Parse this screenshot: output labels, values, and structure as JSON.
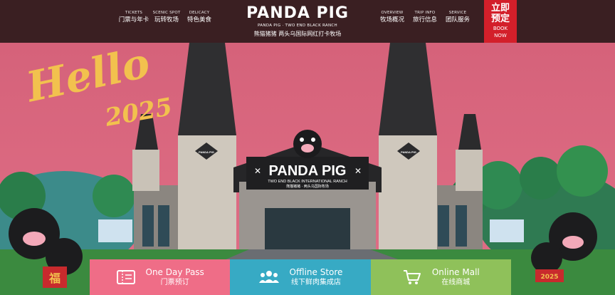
{
  "header": {
    "nav_left": [
      {
        "en": "TICKETS",
        "zh": "门票与年卡"
      },
      {
        "en": "SCENIC SPOT",
        "zh": "玩转牧场"
      },
      {
        "en": "DELICACY",
        "zh": "特色美食"
      }
    ],
    "logo": {
      "title": "PANDA PIG",
      "sub_en": "PANDA PIG · TWO END BLACK RANCH",
      "sub_zh": "熊猫猪猪 两头乌国际网红打卡牧场"
    },
    "nav_right": [
      {
        "en": "OVERVIEW",
        "zh": "牧场概况"
      },
      {
        "en": "TRIP INFO",
        "zh": "旅行信息"
      },
      {
        "en": "SERVICE",
        "zh": "团队服务"
      }
    ],
    "book": {
      "zh1": "立即",
      "zh2": "预定",
      "en1": "BOOK",
      "en2": "NOW"
    }
  },
  "hero": {
    "script_text": "Hello",
    "year_text": "2025",
    "sign_title": "PANDA PIG",
    "sign_sub": "TWO END BLACK INTERNATIONAL RANCH",
    "sign_zh": "熊猫猪猪 · 两头乌国际牧场",
    "tower_badge": "PANDA PIG",
    "fu": "福",
    "banner_year": "2025"
  },
  "actions": [
    {
      "t1": "One Day Pass",
      "t2": "门票预订",
      "icon": "ticket-icon",
      "color": "#ef6d87"
    },
    {
      "t1": "Offline Store",
      "t2": "线下鲜肉集成店",
      "icon": "people-icon",
      "color": "#37aac4"
    },
    {
      "t1": "Online Mall",
      "t2": "在线商城",
      "icon": "cart-icon",
      "color": "#8fc15a"
    }
  ],
  "colors": {
    "header_bg": "#3a1f22",
    "book_bg": "#d31f2a",
    "sky": "#d8647a"
  }
}
